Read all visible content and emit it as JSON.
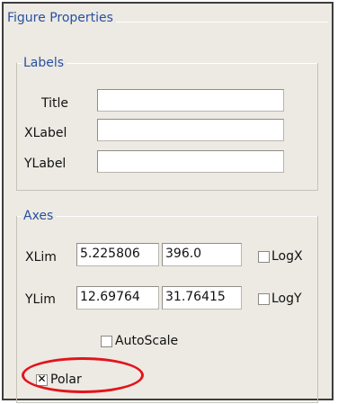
{
  "panel": {
    "title": "Figure Properties"
  },
  "labels_group": {
    "title": "Labels",
    "fields": [
      {
        "label": "Title",
        "value": ""
      },
      {
        "label": "XLabel",
        "value": ""
      },
      {
        "label": "YLabel",
        "value": ""
      }
    ]
  },
  "axes_group": {
    "title": "Axes",
    "xlim": {
      "label": "XLim",
      "min": "5.225806",
      "max": "396.0",
      "log_label": "LogX",
      "log_checked": false
    },
    "ylim": {
      "label": "YLim",
      "min": "12.69764",
      "max": "31.76415",
      "log_label": "LogY",
      "log_checked": false
    },
    "autoscale": {
      "label": "AutoScale",
      "checked": false
    },
    "polar": {
      "label": "Polar",
      "checked": true,
      "mark": "✕"
    }
  },
  "annotation": {
    "highlight_color": "#e3141c",
    "target": "Polar"
  },
  "colors": {
    "panel_bg": "#eceae3",
    "group_title": "#2850a0",
    "border": "#3d3d3d"
  }
}
